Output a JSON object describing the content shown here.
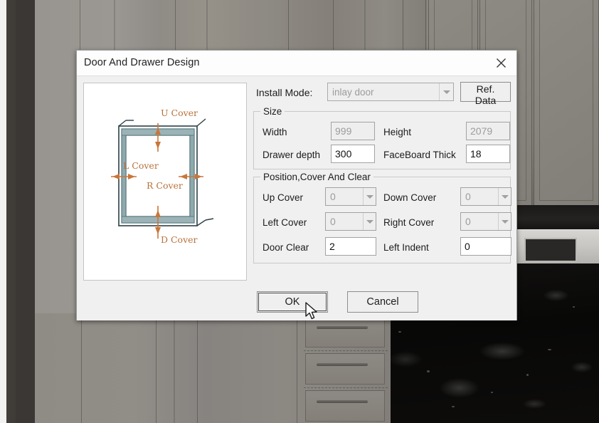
{
  "dialog": {
    "title": "Door And Drawer Design",
    "close_icon": "close-x-icon"
  },
  "preview": {
    "labels": {
      "up": "U Cover",
      "left": "L Cover",
      "right": "R Cover",
      "down": "D Cover"
    },
    "frame_color": "#6f9499",
    "frame_fill": "#9bb3b6",
    "outline_color": "#2b3f45",
    "annotation_color": "#c9763a"
  },
  "install": {
    "label": "Install Mode:",
    "value": "inlay door",
    "disabled": true,
    "ref_button": "Ref. Data",
    "dropdown_icon": "chevron-down-icon"
  },
  "size_group": {
    "title": "Size",
    "fields": [
      {
        "label": "Width",
        "value": "999",
        "disabled": true
      },
      {
        "label": "Height",
        "value": "2079",
        "disabled": true
      },
      {
        "label": "Drawer depth",
        "value": "300",
        "disabled": false
      },
      {
        "label": "FaceBoard Thick",
        "value": "18",
        "disabled": false
      }
    ]
  },
  "position_group": {
    "title": "Position,Cover And Clear",
    "fields": [
      {
        "label": "Up Cover",
        "value": "0",
        "type": "spinner",
        "disabled": true
      },
      {
        "label": "Down Cover",
        "value": "0",
        "type": "spinner",
        "disabled": true
      },
      {
        "label": "Left Cover",
        "value": "0",
        "type": "spinner",
        "disabled": true
      },
      {
        "label": "Right Cover",
        "value": "0",
        "type": "spinner",
        "disabled": true
      },
      {
        "label": "Door Clear",
        "value": "2",
        "type": "text",
        "disabled": false
      },
      {
        "label": "Left Indent",
        "value": "0",
        "type": "text",
        "disabled": false
      }
    ]
  },
  "footer": {
    "ok": "OK",
    "cancel": "Cancel"
  },
  "background": {
    "description": "3D rendered kitchen with gray cabinets and black granite countertop"
  }
}
